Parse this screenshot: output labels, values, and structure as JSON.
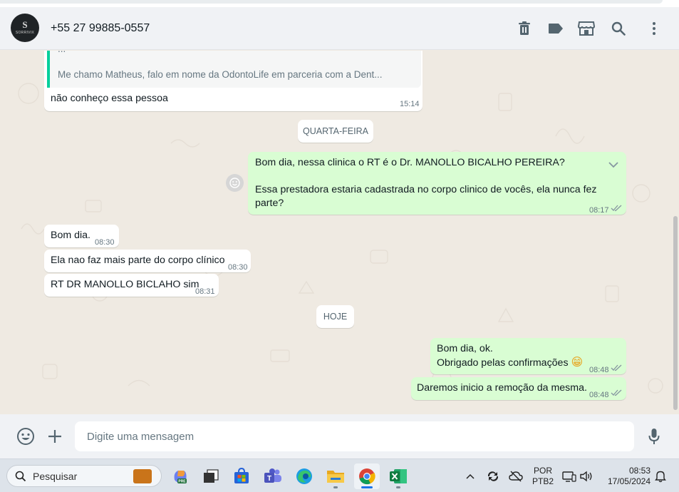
{
  "header": {
    "avatar_text": "S",
    "avatar_subtext": "SORRIVIX",
    "contact_name": "+55 27 99885-0557",
    "icons": [
      "trash-icon",
      "label-icon",
      "catalog-store-icon",
      "search-icon",
      "menu-dots-icon"
    ]
  },
  "messages": {
    "quoted_first_line": "...",
    "quoted_text": "Me chamo Matheus, falo em nome da OdontoLife em parceria com a Dent...",
    "msg1": {
      "text": "não conheço essa pessoa",
      "time": "15:14"
    },
    "day1": "QUARTA-FEIRA",
    "msg2": {
      "line1": "Bom dia, nessa clinica o RT é o Dr. MANOLLO BICALHO PEREIRA?",
      "line2": "Essa prestadora estaria cadastrada no corpo clinico de vocês, ela nunca fez parte?",
      "time": "08:17"
    },
    "msg3": {
      "text": "Bom dia.",
      "time": "08:30"
    },
    "msg4": {
      "text": "Ela nao faz mais parte do corpo clínico",
      "time": "08:30"
    },
    "msg5": {
      "text": "RT DR MANOLLO BICLAHO sim",
      "time": "08:31"
    },
    "day2": "HOJE",
    "msg6": {
      "line1": "Bom dia, ok.",
      "line2": "Obrigado pelas confirmações",
      "emoji": "😁",
      "time": "08:48"
    },
    "msg7": {
      "text": "Daremos inicio a remoção da mesma.",
      "time": "08:48"
    }
  },
  "composer": {
    "placeholder": "Digite uma mensagem",
    "value": ""
  },
  "taskbar": {
    "search_label": "Pesquisar",
    "lang_line1": "POR",
    "lang_line2": "PTB2",
    "time": "08:53",
    "date": "17/05/2024",
    "apps": [
      "copilot-icon",
      "task-view-icon",
      "store-icon",
      "teams-icon",
      "edge-icon",
      "file-explorer-icon",
      "chrome-icon",
      "excel-icon"
    ]
  },
  "colors": {
    "outgoing_bubble": "#d9fdd3",
    "incoming_bubble": "#ffffff",
    "chat_bg": "#efeae2",
    "read_ticks": "#8696a0",
    "quote_bar": "#06cf9c"
  }
}
